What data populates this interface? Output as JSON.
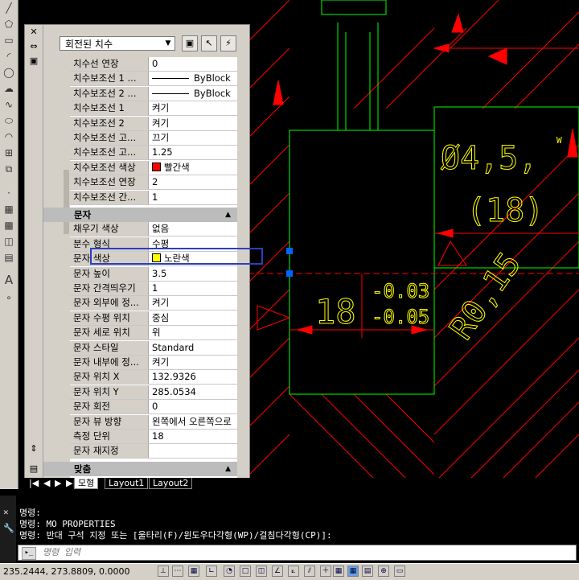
{
  "panel": {
    "dropdown": "회전된 치수",
    "rows_top": [
      {
        "k": "치수선 연장",
        "v": "0"
      },
      {
        "k": "치수보조선 1 ...",
        "v": "ByBlock",
        "line": true
      },
      {
        "k": "치수보조선 2 ...",
        "v": "ByBlock",
        "line": true
      },
      {
        "k": "치수보조선 1",
        "v": "켜기"
      },
      {
        "k": "치수보조선 2",
        "v": "켜기"
      },
      {
        "k": "치수보조선 고...",
        "v": "끄기"
      },
      {
        "k": "치수보조선 고...",
        "v": "1.25"
      },
      {
        "k": "치수보조선 색상",
        "v": "빨간색",
        "swatch": "#ff0000"
      },
      {
        "k": "치수보조선 연장",
        "v": "2"
      },
      {
        "k": "치수보조선 간...",
        "v": "1"
      }
    ],
    "section_text": "문자",
    "rows_text": [
      {
        "k": "채우기 색상",
        "v": "없음"
      },
      {
        "k": "분수 형식",
        "v": "수평"
      },
      {
        "k": "문자 색상",
        "v": "노란색",
        "swatch": "#ffff00"
      },
      {
        "k": "문자 높이",
        "v": "3.5"
      },
      {
        "k": "문자 간격띄우기",
        "v": "1"
      },
      {
        "k": "문자 외부에 정...",
        "v": "켜기"
      },
      {
        "k": "문자 수평 위치",
        "v": "중심"
      },
      {
        "k": "문자 세로 위치",
        "v": "위"
      },
      {
        "k": "문자 스타일",
        "v": "Standard"
      },
      {
        "k": "문자 내부에 정...",
        "v": "켜기"
      },
      {
        "k": "문자 위치 X",
        "v": "132.9326"
      },
      {
        "k": "문자 위치 Y",
        "v": "285.0534"
      },
      {
        "k": "문자 회전",
        "v": "0"
      },
      {
        "k": "문자 뷰 방향",
        "v": "왼쪽에서 오른쪽으로"
      },
      {
        "k": "측정 단위",
        "v": "18"
      },
      {
        "k": "문자 재지정",
        "v": ""
      }
    ],
    "section_bottom": "맞춤"
  },
  "layout_tabs": [
    "모형",
    "Layout1",
    "Layout2"
  ],
  "command": {
    "lines": [
      "명령:",
      "명령: MO PROPERTIES",
      "명령: 반대 구석 지정 또는 [울타리(F)/윈도우다각형(WP)/걸침다각형(CP)]:"
    ],
    "placeholder": "명령 입력"
  },
  "status": {
    "coords": "235.2444, 273.8809, 0.0000"
  },
  "drawing": {
    "text_dia": "Ø4,5,",
    "text_w": "W",
    "text_18p": "(18)",
    "text_18": "18",
    "tol_upper": "-0.03",
    "tol_lower": "-0.05",
    "text_r": "R0,15"
  },
  "colors": {
    "dim": "#ff0000",
    "text": "#ffff00",
    "geom": "#00ff00",
    "grip": "#0066ff",
    "highlight": "#2c3fc0"
  }
}
